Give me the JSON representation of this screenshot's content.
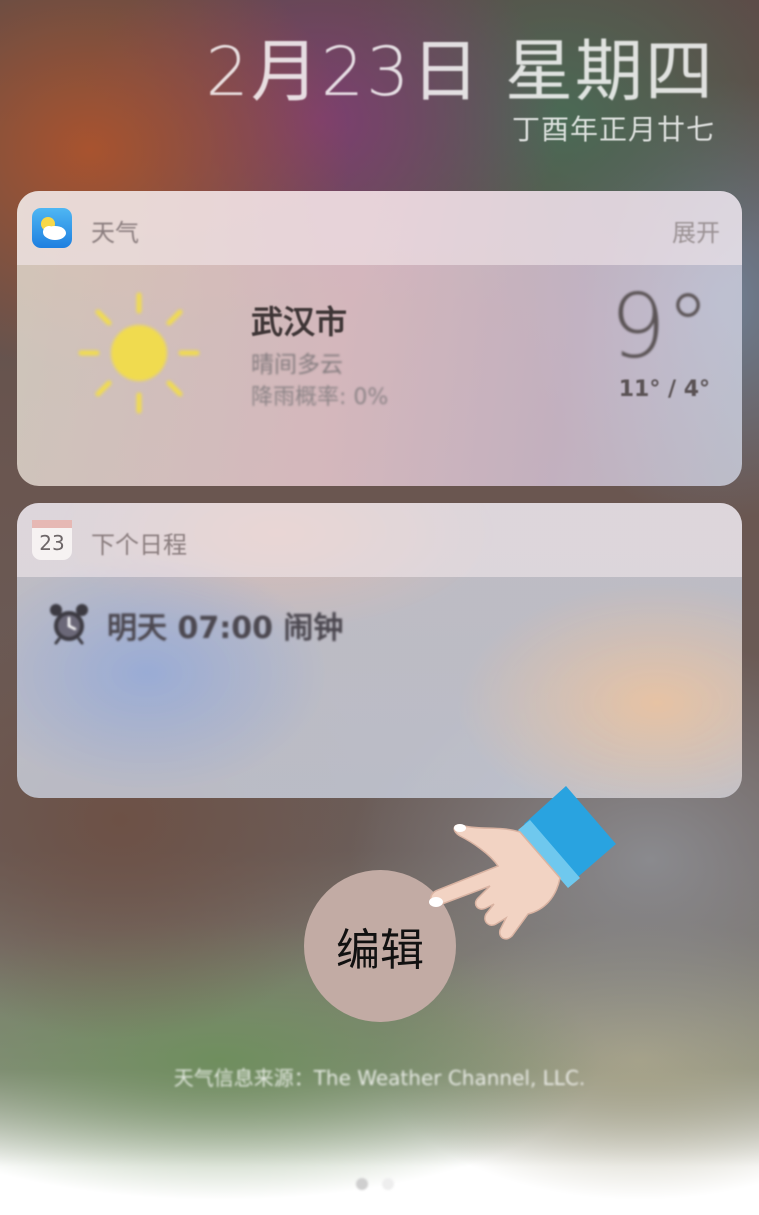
{
  "header": {
    "date": "2月23日 星期四",
    "lunar_date": "丁酉年正月廿七"
  },
  "weather_widget": {
    "app_name": "天气",
    "expand_label": "展开",
    "city": "武汉市",
    "condition": "晴间多云",
    "precipitation": "降雨概率: 0%",
    "current_temp": "9°",
    "temp_range": "11° / 4°",
    "icon": "sun-icon"
  },
  "calendar_widget": {
    "app_name": "下个日程",
    "icon_date": "23",
    "event": "明天 07:00 闹钟",
    "icon": "alarm-clock-icon"
  },
  "edit_button": {
    "label": "编辑"
  },
  "footer": {
    "attribution": "天气信息来源：The Weather Channel, LLC.",
    "pages": 2,
    "active_page": 1
  },
  "colors": {
    "weather_icon": "#2a8ae6",
    "sun": "#f0db4f",
    "edit_button": "#c2aba4",
    "hand_sleeve": "#29a3e0"
  }
}
